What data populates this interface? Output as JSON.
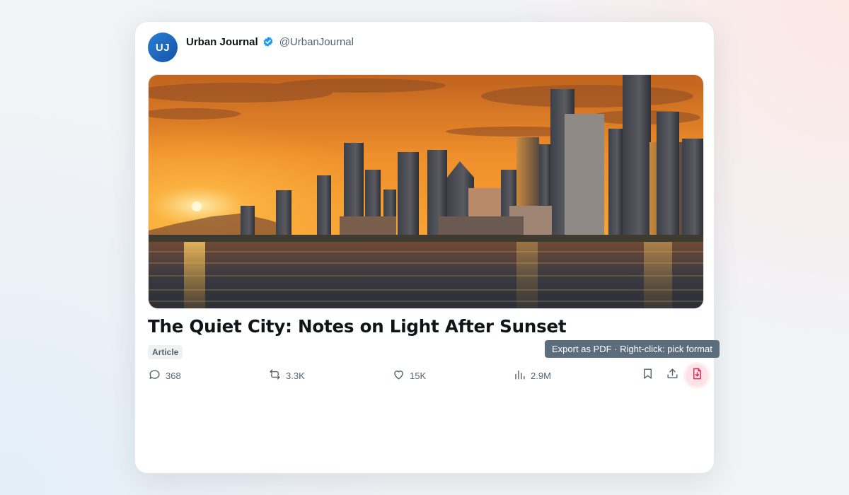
{
  "post": {
    "avatar_initials": "UJ",
    "author_name": "Urban Journal",
    "handle": "@UrbanJournal",
    "title": "The Quiet City: Notes on Light After Sunset",
    "badge": "Article"
  },
  "actions": {
    "replies": "368",
    "reposts": "3.3K",
    "likes": "15K",
    "views": "2.9M"
  },
  "tooltip": {
    "text": "Export as PDF · Right-click: pick format"
  },
  "colors": {
    "verified": "#1d9bf0",
    "pdf_accent": "#e0245e",
    "muted_text": "#536471"
  },
  "icons": {
    "verified": "verified-badge-icon",
    "reply": "speech-bubble-icon",
    "repost": "repost-arrows-icon",
    "like": "heart-icon",
    "views": "bar-chart-icon",
    "bookmark": "bookmark-icon",
    "share": "upload-share-icon",
    "export_pdf": "pdf-file-icon"
  }
}
